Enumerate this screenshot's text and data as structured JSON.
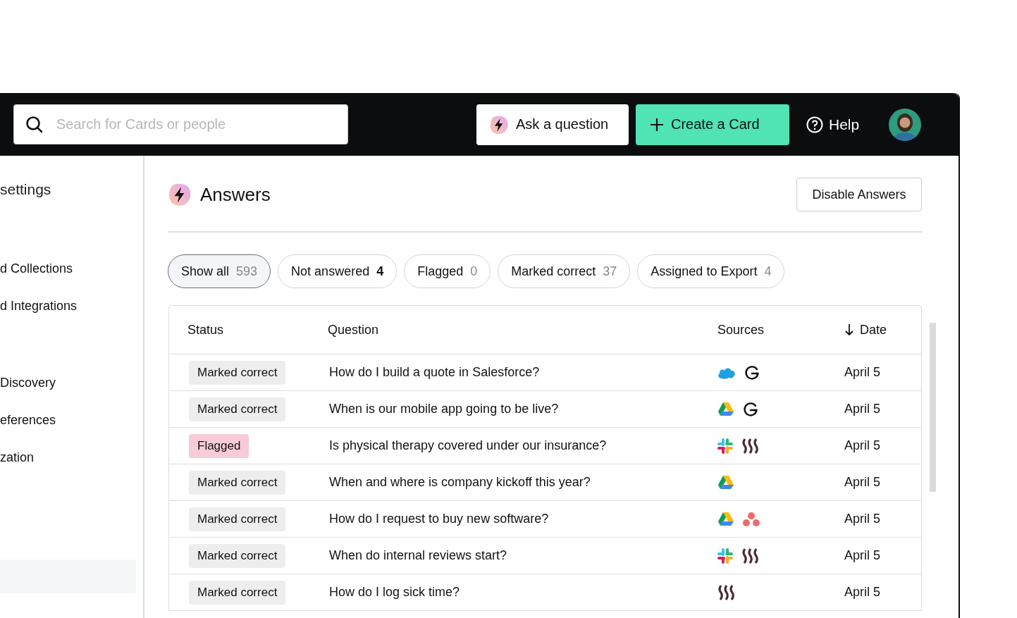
{
  "header": {
    "search": {
      "placeholder": "Search for Cards or people"
    },
    "ask_button": "Ask a question",
    "create_button": "Create a Card",
    "help": "Help"
  },
  "sidebar": {
    "heading": "settings",
    "items": [
      {
        "label": "d Collections"
      },
      {
        "label": "d Integrations"
      },
      {
        "label": "Discovery"
      },
      {
        "label": "eferences"
      },
      {
        "label": "zation"
      }
    ]
  },
  "page": {
    "title": "Answers",
    "disable_button": "Disable Answers"
  },
  "filters": [
    {
      "label": "Show all",
      "count": "593",
      "selected": true,
      "count_strong": false
    },
    {
      "label": "Not answered",
      "count": "4",
      "selected": false,
      "count_strong": true
    },
    {
      "label": "Flagged",
      "count": "0",
      "selected": false,
      "count_strong": false
    },
    {
      "label": "Marked correct",
      "count": "37",
      "selected": false,
      "count_strong": false
    },
    {
      "label": "Assigned to Export",
      "count": "4",
      "selected": false,
      "count_strong": false
    }
  ],
  "table": {
    "columns": [
      "Status",
      "Question",
      "Sources",
      "Date"
    ],
    "rows": [
      {
        "status": {
          "label": "Marked correct",
          "kind": "correct"
        },
        "question": "How do I build a quote in Salesforce?",
        "sources": [
          {
            "kind": "cloud"
          },
          {
            "kind": "swirl"
          }
        ],
        "date": "April 5"
      },
      {
        "status": {
          "label": "Marked correct",
          "kind": "correct"
        },
        "question": "When is our mobile app going to be live?",
        "sources": [
          {
            "kind": "triangle"
          },
          {
            "kind": "swirl"
          }
        ],
        "date": "April 5"
      },
      {
        "status": {
          "label": "Flagged",
          "kind": "flagged"
        },
        "question": "Is physical therapy covered under our insurance?",
        "sources": [
          {
            "kind": "pinwheel"
          },
          {
            "kind": "squiggle"
          }
        ],
        "date": "April 5"
      },
      {
        "status": {
          "label": "Marked correct",
          "kind": "correct"
        },
        "question": "When and where is company kickoff this year?",
        "sources": [
          {
            "kind": "triangle"
          }
        ],
        "date": "April 5"
      },
      {
        "status": {
          "label": "Marked correct",
          "kind": "correct"
        },
        "question": "How do I request to buy new software?",
        "sources": [
          {
            "kind": "triangle"
          },
          {
            "kind": "dots"
          }
        ],
        "date": "April 5"
      },
      {
        "status": {
          "label": "Marked correct",
          "kind": "correct"
        },
        "question": "When do internal reviews start?",
        "sources": [
          {
            "kind": "pinwheel"
          },
          {
            "kind": "squiggle"
          }
        ],
        "date": "April 5"
      },
      {
        "status": {
          "label": "Marked correct",
          "kind": "correct"
        },
        "question": "How do I log sick time?",
        "sources": [
          {
            "kind": "squiggle"
          }
        ],
        "date": "April 5"
      }
    ]
  }
}
